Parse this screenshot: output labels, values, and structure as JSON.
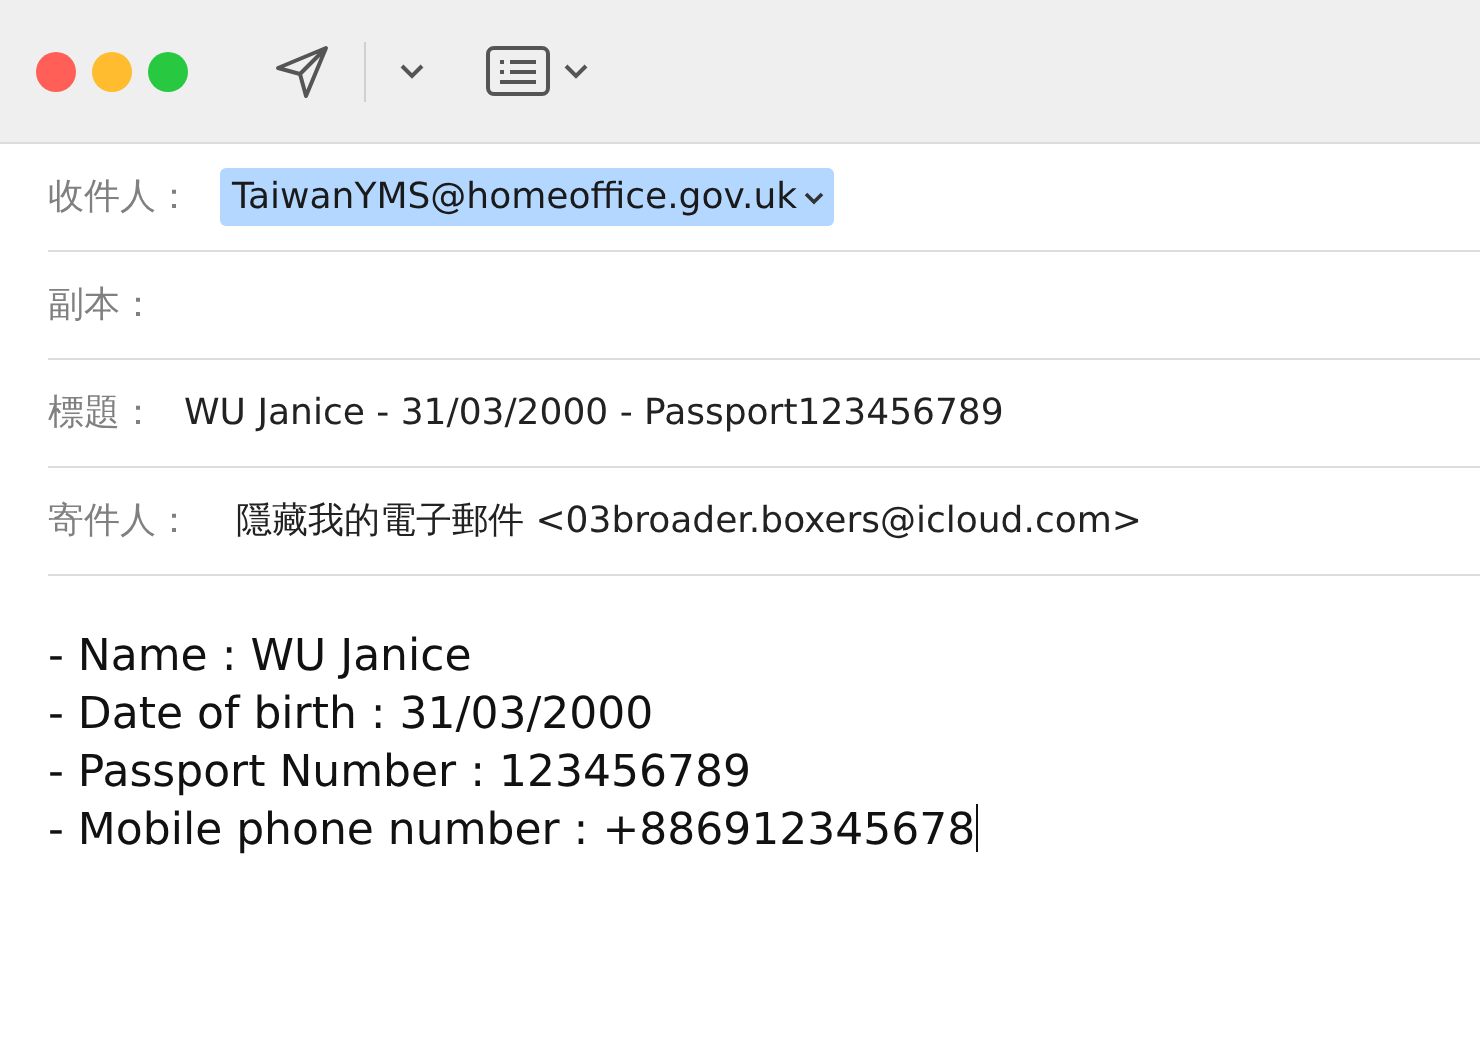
{
  "header_fields": [
    {
      "label": "收件人：",
      "kind": "token",
      "value": "TaiwanYMS@homeoffice.gov.uk",
      "selected": true
    },
    {
      "label": "副本：",
      "kind": "text"
    },
    {
      "label": "標題：",
      "kind": "text",
      "value": "WU Janice - 31/03/2000 - Passport123456789"
    },
    {
      "label": "寄件人：",
      "kind": "text",
      "value": "隱藏我的電子郵件 <03broader.boxers@icloud.com>"
    }
  ],
  "body_lines": [
    "- Name : WU Janice",
    "- Date of birth : 31/03/2000",
    "- Passport Number : 123456789",
    "- Mobile phone number : +886912345678"
  ]
}
